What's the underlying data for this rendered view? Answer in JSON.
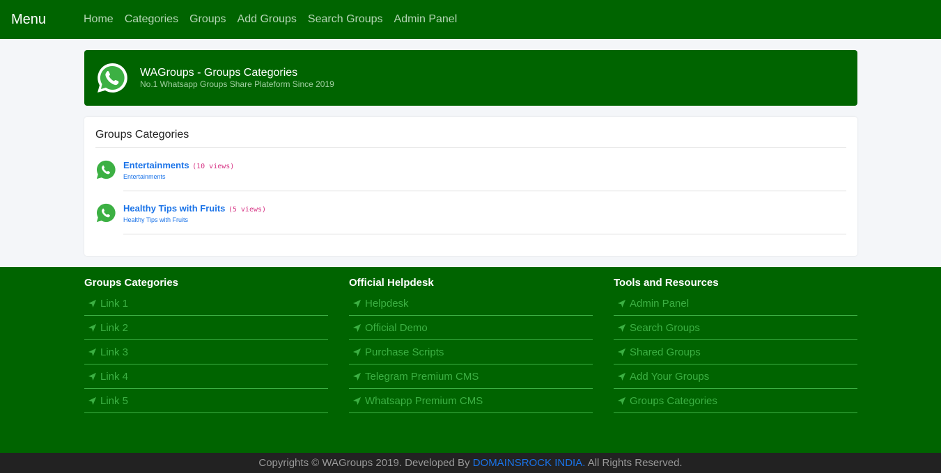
{
  "nav": {
    "brand": "Menu",
    "links": [
      "Home",
      "Categories",
      "Groups",
      "Add Groups",
      "Search Groups",
      "Admin Panel"
    ]
  },
  "hero": {
    "title": "WAGroups - Groups Categories",
    "subtitle": "No.1 Whatsapp Groups Share Plateform Since 2019"
  },
  "card": {
    "title": "Groups Categories",
    "items": [
      {
        "name": "Entertainments",
        "views": "(10 views)",
        "sub": "Entertainments"
      },
      {
        "name": "Healthy Tips with Fruits",
        "views": "(5 views)",
        "sub": "Healthy Tips with Fruits"
      }
    ]
  },
  "footer": {
    "columns": [
      {
        "title": "Groups Categories",
        "links": [
          "Link 1",
          "Link 2",
          "Link 3",
          "Link 4",
          "Link 5"
        ]
      },
      {
        "title": "Official Helpdesk",
        "links": [
          "Helpdesk",
          "Official Demo",
          "Purchase Scripts",
          "Telegram Premium CMS",
          "Whatsapp Premium CMS"
        ]
      },
      {
        "title": "Tools and Resources",
        "links": [
          "Admin Panel",
          "Search Groups",
          "Shared Groups",
          "Add Your Groups",
          "Groups Categories"
        ]
      }
    ]
  },
  "copyright": {
    "before": "Copyrights © WAGroups 2019. Developed By ",
    "link": "DOMAINSROCK INDIA.",
    "after": " All Rights Reserved."
  }
}
